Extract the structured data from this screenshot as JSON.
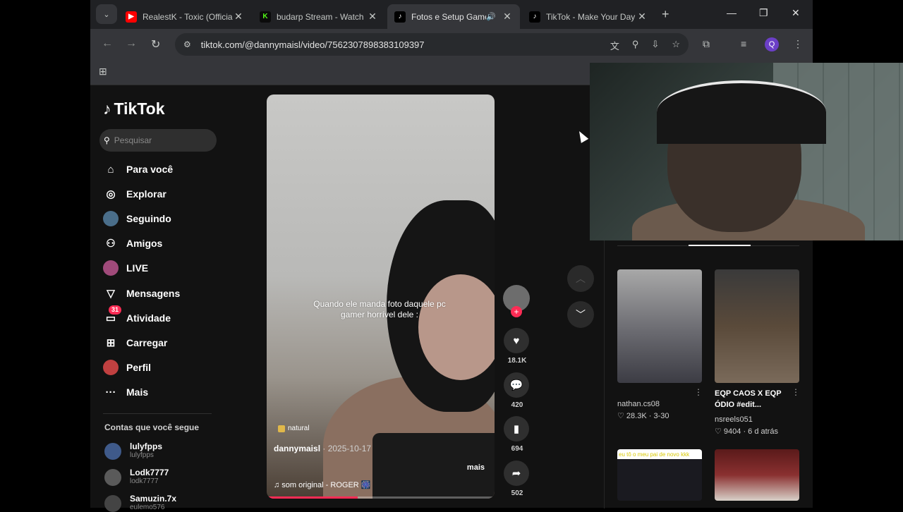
{
  "tabs": [
    {
      "title": "RealestK - Toxic (Official",
      "fav": "▶",
      "fav_color": "#ff0000"
    },
    {
      "title": "budarp Stream - Watch",
      "fav": "K",
      "fav_color": "#53fc18"
    },
    {
      "title": "Fotos e Setup Gamer",
      "fav": "♪",
      "fav_color": "#000000"
    },
    {
      "title": "TikTok - Make Your Day",
      "fav": "♪",
      "fav_color": "#000000"
    }
  ],
  "omnibox": {
    "url": "tiktok.com/@dannymaisl/video/7562307898383109397"
  },
  "profile_initial": "Q",
  "sidebar": {
    "logo": "TikTok",
    "search_placeholder": "Pesquisar",
    "menu": [
      {
        "label": "Para você",
        "icon": "home-icon",
        "glyph": "⌂"
      },
      {
        "label": "Explorar",
        "icon": "compass-icon",
        "glyph": "◎"
      },
      {
        "label": "Seguindo",
        "icon": "following-icon",
        "glyph": "●"
      },
      {
        "label": "Amigos",
        "icon": "friends-icon",
        "glyph": "⚇"
      },
      {
        "label": "LIVE",
        "icon": "live-icon",
        "glyph": "●"
      },
      {
        "label": "Mensagens",
        "icon": "messages-icon",
        "glyph": "▽"
      },
      {
        "label": "Atividade",
        "icon": "activity-icon",
        "glyph": "▭",
        "badge": "31"
      },
      {
        "label": "Carregar",
        "icon": "upload-icon",
        "glyph": "⊞"
      },
      {
        "label": "Perfil",
        "icon": "profile-icon",
        "glyph": "●"
      },
      {
        "label": "Mais",
        "icon": "more-icon",
        "glyph": "···"
      }
    ],
    "following_title": "Contas que você segue",
    "accounts": [
      {
        "name": "lulyfpps",
        "handle": "lulyfpps"
      },
      {
        "name": "Lodk7777",
        "handle": "lodk7777"
      },
      {
        "name": "Samuzin.7x",
        "handle": "eulemo576"
      }
    ]
  },
  "video": {
    "caption": "Quando ele manda foto daquele pc gamer horrível dele :",
    "tag": "natural",
    "author": "dannymaisl",
    "date": "· 2025-10-17",
    "more": "mais",
    "sound": "♫  som original - ROGER 🎆"
  },
  "actions": {
    "likes": "18.1K",
    "comments": "420",
    "saves": "694",
    "shares": "502"
  },
  "related": [
    {
      "title": "",
      "user": "nathan.cs08",
      "stats": "♡ 28.3K  ·  3-30"
    },
    {
      "title": "EQP CAOS X EQP ÓDIO #edit...",
      "user": "nsreels051",
      "stats": "♡ 9404  ·  6 d atrás"
    }
  ],
  "related_overlay_text": "eu tô o meu pai de novo kkk"
}
